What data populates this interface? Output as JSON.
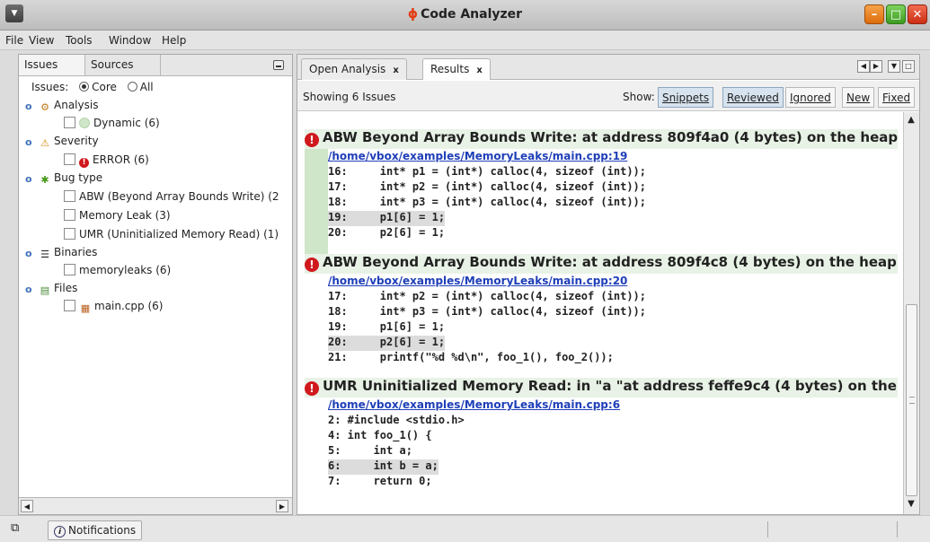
{
  "window": {
    "title": "Code Analyzer"
  },
  "menu": [
    "File",
    "View",
    "Tools",
    "Window",
    "Help"
  ],
  "left": {
    "tabs": [
      "Issues",
      "Sources"
    ],
    "issues_label": "Issues:",
    "radio": [
      "Core",
      "All"
    ],
    "tree": {
      "analysis": "Analysis",
      "dynamic": "Dynamic (6)",
      "severity": "Severity",
      "error": "ERROR (6)",
      "bugtype": "Bug type",
      "abw": "ABW (Beyond Array Bounds Write) (2",
      "leak": "Memory Leak (3)",
      "umr": "UMR (Uninitialized Memory Read) (1)",
      "binaries": "Binaries",
      "memoryleaks": "memoryleaks (6)",
      "files": "Files",
      "main": "main.cpp (6)"
    }
  },
  "right": {
    "tabs": [
      "Open Analysis",
      "Results"
    ],
    "showing": "Showing 6 Issues",
    "show_label": "Show:",
    "filters": [
      "Snippets",
      "Reviewed",
      "Ignored",
      "New",
      "Fixed"
    ],
    "issues": [
      {
        "title": "ABW Beyond Array Bounds Write: at address 809f4a0 (4 bytes) on the heap",
        "path": "/home/vbox/examples/MemoryLeaks/main.cpp:19",
        "lines": [
          "16:     int* p1 = (int*) calloc(4, sizeof (int));",
          "17:     int* p2 = (int*) calloc(4, sizeof (int));",
          "18:     int* p3 = (int*) calloc(4, sizeof (int));",
          "19:     p1[6] = 1;",
          "20:     p2[6] = 1;"
        ]
      },
      {
        "title": "ABW Beyond Array Bounds Write: at address 809f4c8 (4 bytes) on the heap",
        "path": "/home/vbox/examples/MemoryLeaks/main.cpp:20",
        "lines": [
          "17:     int* p2 = (int*) calloc(4, sizeof (int));",
          "18:     int* p3 = (int*) calloc(4, sizeof (int));",
          "19:     p1[6] = 1;",
          "20:     p2[6] = 1;",
          "21:     printf(\"%d %d\\n\", foo_1(), foo_2());"
        ]
      },
      {
        "title": "UMR Uninitialized Memory Read: in \"a \"at address feffe9c4 (4 bytes) on the",
        "path": "/home/vbox/examples/MemoryLeaks/main.cpp:6",
        "lines": [
          "2: #include <stdio.h>",
          "4: int foo_1() {",
          "5:     int a;",
          "6:     int b = a;",
          "7:     return 0;"
        ]
      }
    ]
  },
  "status": {
    "notifications": "Notifications"
  }
}
